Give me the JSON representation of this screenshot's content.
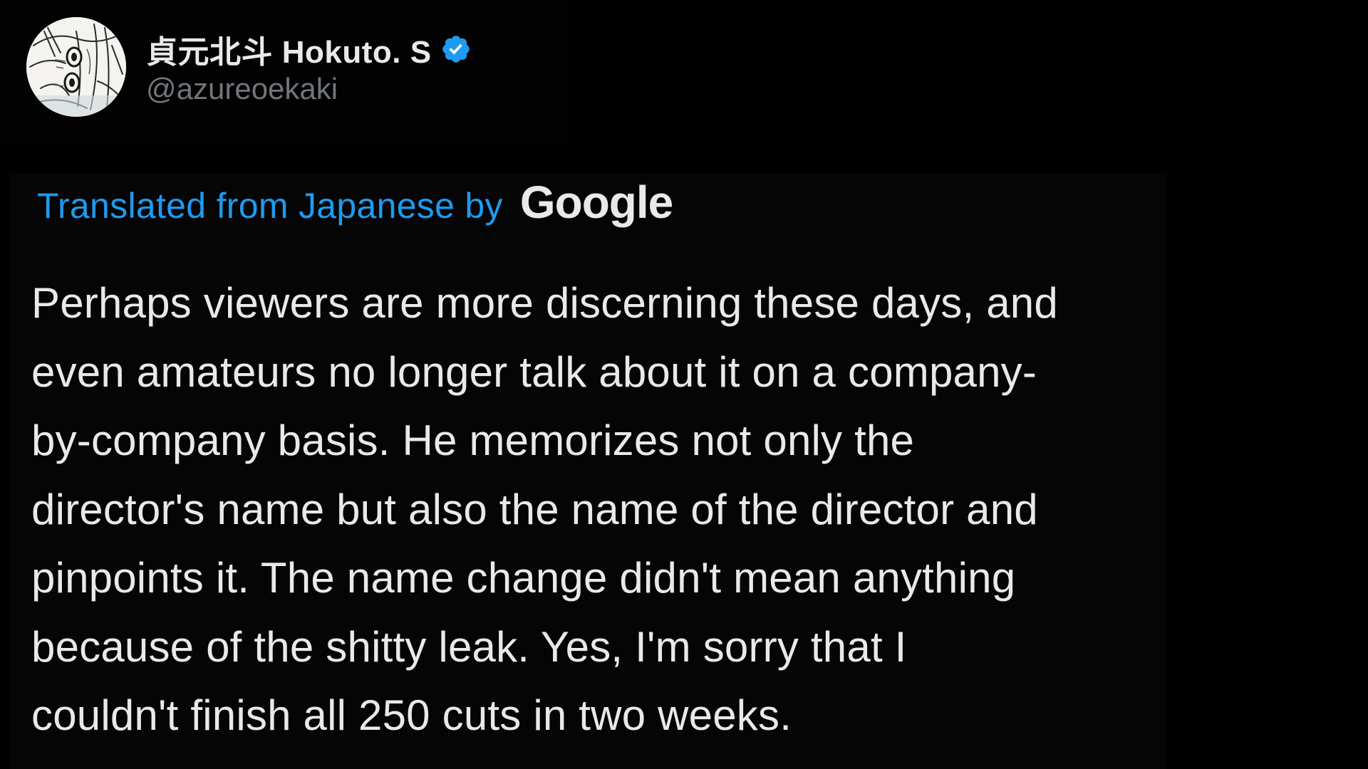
{
  "author": {
    "display_name": "貞元北斗 Hokuto. S",
    "handle": "@azureoekaki",
    "verified": true,
    "avatar_icon": "manga-sketch-avatar"
  },
  "translation": {
    "label": "Translated from Japanese by",
    "provider": "Google"
  },
  "tweet": {
    "lines": [
      "Perhaps viewers are more discerning these days, and",
      "even amateurs no longer talk about it on a company-",
      "by-company basis. He memorizes not only the",
      "director's name but also the name of the director and",
      "pinpoints it. The name change didn't mean anything",
      "because of the shitty leak. Yes, I'm sorry that I",
      "couldn't finish all 250 cuts in two weeks."
    ]
  },
  "colors": {
    "background": "#000000",
    "text": "#e7e9ea",
    "handle": "#71767b",
    "link": "#1d9bf0",
    "verified": "#1d9bf0"
  }
}
